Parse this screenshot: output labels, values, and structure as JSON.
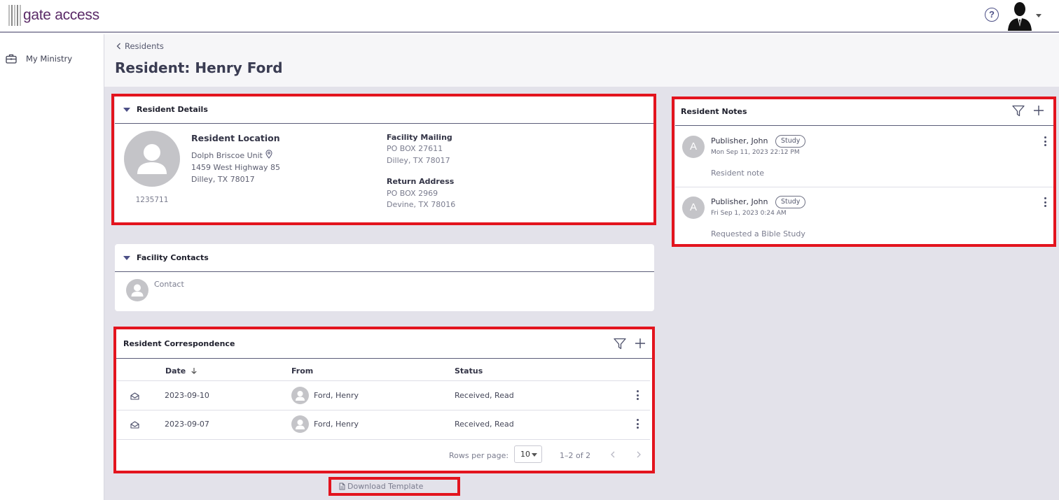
{
  "app": {
    "logo_text": "gate access"
  },
  "sidebar": {
    "items": [
      {
        "label": "My Ministry"
      }
    ]
  },
  "breadcrumb": {
    "back_label": "Residents"
  },
  "page": {
    "title": "Resident: Henry Ford"
  },
  "resident_details": {
    "title": "Resident Details",
    "id": "1235711",
    "location_title": "Resident Location",
    "location_name": "Dolph Briscoe Unit",
    "location_line2": "1459 West Highway 85",
    "location_line3": "Dilley, TX 78017",
    "mailing_title": "Facility Mailing",
    "mailing_line1": "PO BOX 27611",
    "mailing_line2": "Dilley, TX 78017",
    "return_title": "Return Address",
    "return_line1": "PO BOX 2969",
    "return_line2": "Devine, TX 78016"
  },
  "facility_contacts": {
    "title": "Facility Contacts",
    "contact_label": "Contact"
  },
  "notes": {
    "title": "Resident Notes",
    "items": [
      {
        "initial": "A",
        "name": "Publisher, John",
        "badge": "Study",
        "date": "Mon Sep 11, 2023 22:12 PM",
        "body": "Resident note"
      },
      {
        "initial": "A",
        "name": "Publisher, John",
        "badge": "Study",
        "date": "Fri Sep 1, 2023 0:24 AM",
        "body": "Requested a Bible Study"
      }
    ]
  },
  "correspondence": {
    "title": "Resident Correspondence",
    "columns": {
      "date": "Date",
      "from": "From",
      "status": "Status"
    },
    "rows": [
      {
        "date": "2023-09-10",
        "from": "Ford, Henry",
        "status": "Received, Read"
      },
      {
        "date": "2023-09-07",
        "from": "Ford, Henry",
        "status": "Received, Read"
      }
    ],
    "rows_per_page_label": "Rows per page:",
    "rows_per_page_value": "10",
    "range_label": "1–2 of 2"
  },
  "download": {
    "label": "Download Template"
  },
  "colors": {
    "highlight": "#e3141e",
    "accent": "#4c4f86",
    "brand": "#5a2a67"
  }
}
